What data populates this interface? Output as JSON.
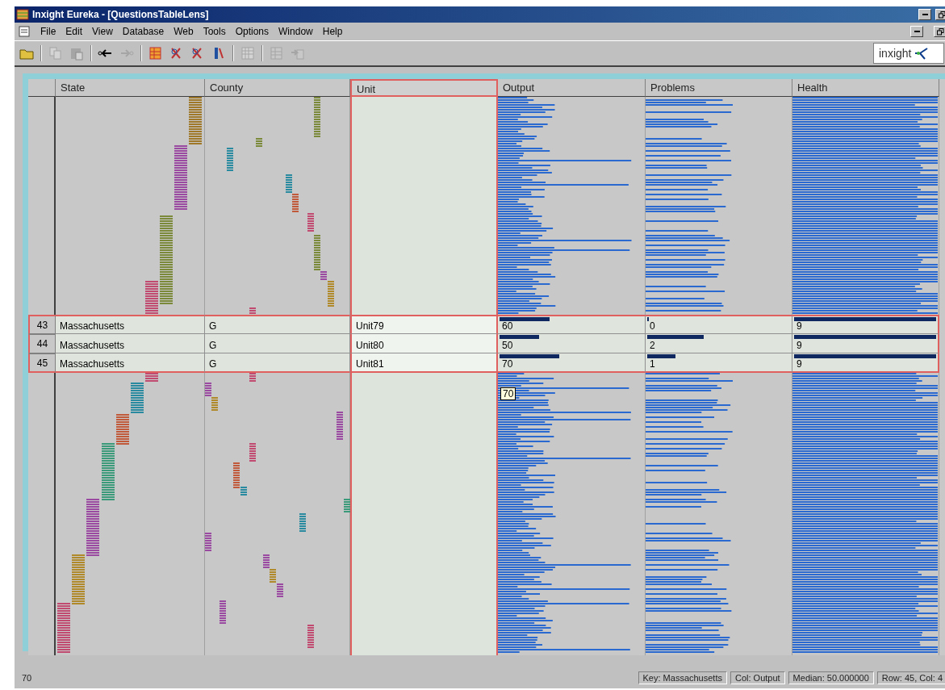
{
  "window": {
    "title": "Inxight Eureka - [QuestionsTableLens]"
  },
  "menu": [
    "File",
    "Edit",
    "View",
    "Database",
    "Web",
    "Tools",
    "Options",
    "Window",
    "Help"
  ],
  "toolbar": [
    {
      "kind": "open",
      "disabled": false
    },
    {
      "kind": "copy",
      "disabled": true
    },
    {
      "kind": "paste",
      "disabled": true
    },
    {
      "kind": "back",
      "disabled": false
    },
    {
      "kind": "forward",
      "disabled": true
    },
    {
      "kind": "table",
      "disabled": false
    },
    {
      "kind": "filter",
      "disabled": false
    },
    {
      "kind": "filter",
      "disabled": false
    },
    {
      "kind": "sort",
      "disabled": false
    },
    {
      "kind": "grid",
      "disabled": true
    },
    {
      "kind": "table",
      "disabled": true
    },
    {
      "kind": "import",
      "disabled": true
    }
  ],
  "logo": {
    "text": "inxight"
  },
  "table": {
    "columns": [
      {
        "label": "State",
        "kind": "category",
        "selected": false
      },
      {
        "label": "County",
        "kind": "category",
        "selected": false
      },
      {
        "label": "Unit",
        "kind": "text",
        "selected": true
      },
      {
        "label": "Output",
        "kind": "numeric",
        "selected": false
      },
      {
        "label": "Problems",
        "kind": "numeric",
        "selected": false
      },
      {
        "label": "Health",
        "kind": "numeric",
        "selected": false
      }
    ],
    "focus_rows": [
      {
        "number": "43",
        "cells": [
          {
            "text": "Massachusetts"
          },
          {
            "text": "G"
          },
          {
            "text": "Unit79"
          },
          {
            "text": "60",
            "level": 0.35
          },
          {
            "text": "0",
            "level": 0
          },
          {
            "text": "9",
            "level": 1
          }
        ]
      },
      {
        "number": "44",
        "cells": [
          {
            "text": "Massachusetts"
          },
          {
            "text": "G"
          },
          {
            "text": "Unit80"
          },
          {
            "text": "50",
            "level": 0.28
          },
          {
            "text": "2",
            "level": 0.4
          },
          {
            "text": "9",
            "level": 1
          }
        ]
      },
      {
        "number": "45",
        "cells": [
          {
            "text": "Massachusetts"
          },
          {
            "text": "G"
          },
          {
            "text": "Unit81"
          },
          {
            "text": "70",
            "level": 0.42
          },
          {
            "text": "1",
            "level": 0.2
          },
          {
            "text": "9",
            "level": 1
          }
        ]
      }
    ],
    "tooltip": "70"
  },
  "status_bar": [
    "70",
    "Key: Massachusetts",
    "Col: Output",
    "Median: 50.000000",
    "Row: 45, Col: 4"
  ]
}
